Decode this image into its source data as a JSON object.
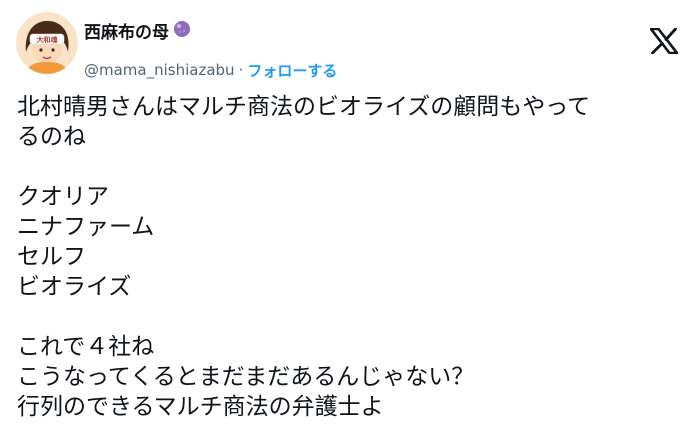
{
  "author": {
    "display_name": "西麻布の母",
    "handle": "@mama_nishiazabu",
    "separator": "·",
    "follow_label": "フォローする",
    "avatar_badge_text": "大和魂"
  },
  "icons": {
    "x_logo": "x-logo-icon",
    "orb": "crystal-ball-icon"
  },
  "colors": {
    "text_primary": "#0f1419",
    "text_secondary": "#536471",
    "link_blue": "#1d9bf0",
    "avatar_bg": "#f6c89a",
    "orb_purple": "#8e6bbf"
  },
  "tweet": {
    "paragraph1": [
      "北村晴男さんはマルチ商法のビオライズの顧問もやって",
      "るのね"
    ],
    "paragraph2": [
      "クオリア",
      "ニナファーム",
      "セルフ",
      "ビオライズ"
    ],
    "paragraph3": [
      "これで４社ね",
      "こうなってくるとまだまだあるんじゃない？",
      "行列のできるマルチ商法の弁護士よ"
    ]
  }
}
